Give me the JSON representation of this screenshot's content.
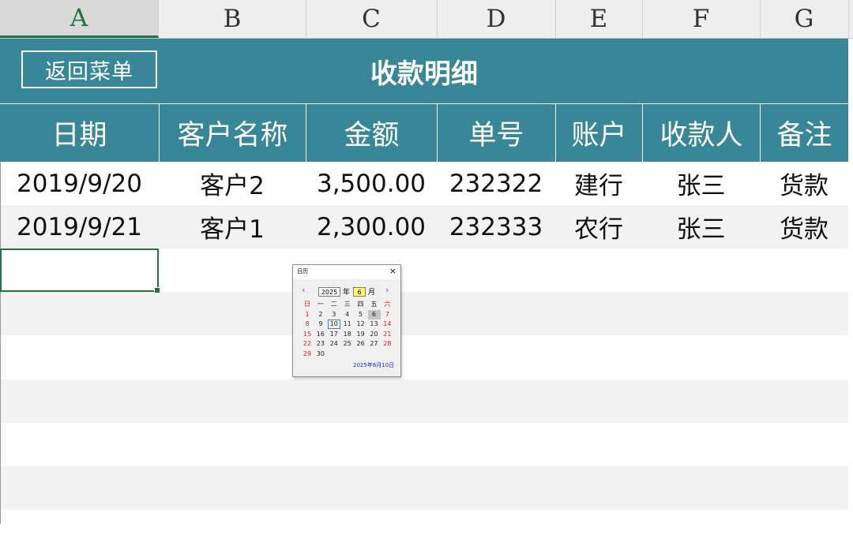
{
  "columns": [
    "A",
    "B",
    "C",
    "D",
    "E",
    "F",
    "G"
  ],
  "active_column": "A",
  "back_button": "返回菜单",
  "title": "收款明细",
  "headers": [
    "日期",
    "客户名称",
    "金额",
    "单号",
    "账户",
    "收款人",
    "备注"
  ],
  "rows": [
    [
      "2019/9/20",
      "客户2",
      "3,500.00",
      "232322",
      "建行",
      "张三",
      "货款"
    ],
    [
      "2019/9/21",
      "客户1",
      "2,300.00",
      "232333",
      "农行",
      "张三",
      "货款"
    ]
  ],
  "colors": {
    "accent": "#378799",
    "selection": "#217346",
    "stripe": "#f2f2f2"
  },
  "calendar": {
    "title": "日历",
    "close": "×",
    "prev": "‹",
    "next": "›",
    "year": "2025",
    "year_label": "年",
    "month": "6",
    "month_label": "月",
    "weekdays": [
      "日",
      "一",
      "二",
      "三",
      "四",
      "五",
      "六"
    ],
    "days": [
      "1",
      "2",
      "3",
      "4",
      "5",
      "6",
      "7",
      "8",
      "9",
      "10",
      "11",
      "12",
      "13",
      "14",
      "15",
      "16",
      "17",
      "18",
      "19",
      "20",
      "21",
      "22",
      "23",
      "24",
      "25",
      "26",
      "27",
      "28",
      "29",
      "30"
    ],
    "today": "10",
    "highlighted": "6",
    "footer": "2025年6月10日"
  }
}
